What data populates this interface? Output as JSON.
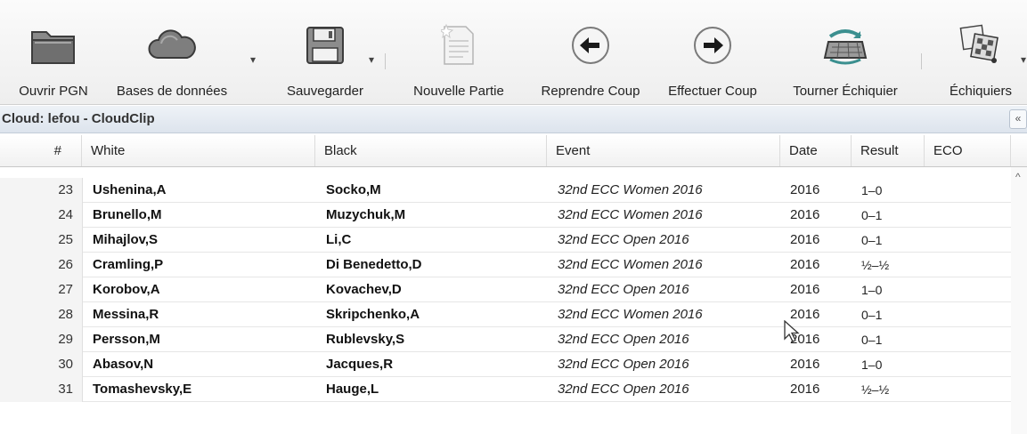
{
  "toolbar": {
    "open_pgn": "Ouvrir PGN",
    "databases": "Bases de données",
    "save": "Sauvegarder",
    "new_game": "Nouvelle Partie",
    "undo_move": "Reprendre Coup",
    "make_move": "Effectuer Coup",
    "flip_board": "Tourner Échiquier",
    "boards": "Échiquiers"
  },
  "section": {
    "title": "Cloud: lefou - CloudClip",
    "collapse_glyph": "«"
  },
  "table": {
    "headers": [
      "#",
      "White",
      "Black",
      "Event",
      "Date",
      "Result",
      "ECO"
    ],
    "rows": [
      {
        "num": "23",
        "white": "Ushenina,A",
        "black": "Socko,M",
        "event": "32nd ECC Women 2016",
        "date": "2016",
        "result": "1–0"
      },
      {
        "num": "24",
        "white": "Brunello,M",
        "black": "Muzychuk,M",
        "event": "32nd ECC Women 2016",
        "date": "2016",
        "result": "0–1"
      },
      {
        "num": "25",
        "white": "Mihajlov,S",
        "black": "Li,C",
        "event": "32nd ECC Open 2016",
        "date": "2016",
        "result": "0–1"
      },
      {
        "num": "26",
        "white": "Cramling,P",
        "black": "Di Benedetto,D",
        "event": "32nd ECC Women 2016",
        "date": "2016",
        "result": "½–½"
      },
      {
        "num": "27",
        "white": "Korobov,A",
        "black": "Kovachev,D",
        "event": "32nd ECC Open 2016",
        "date": "2016",
        "result": "1–0"
      },
      {
        "num": "28",
        "white": "Messina,R",
        "black": "Skripchenko,A",
        "event": "32nd ECC Women 2016",
        "date": "2016",
        "result": "0–1"
      },
      {
        "num": "29",
        "white": "Persson,M",
        "black": "Rublevsky,S",
        "event": "32nd ECC Open 2016",
        "date": "2016",
        "result": "0–1"
      },
      {
        "num": "30",
        "white": "Abasov,N",
        "black": "Jacques,R",
        "event": "32nd ECC Open 2016",
        "date": "2016",
        "result": "1–0"
      },
      {
        "num": "31",
        "white": "Tomashevsky,E",
        "black": "Hauge,L",
        "event": "32nd ECC Open 2016",
        "date": "2016",
        "result": "½–½"
      }
    ]
  }
}
